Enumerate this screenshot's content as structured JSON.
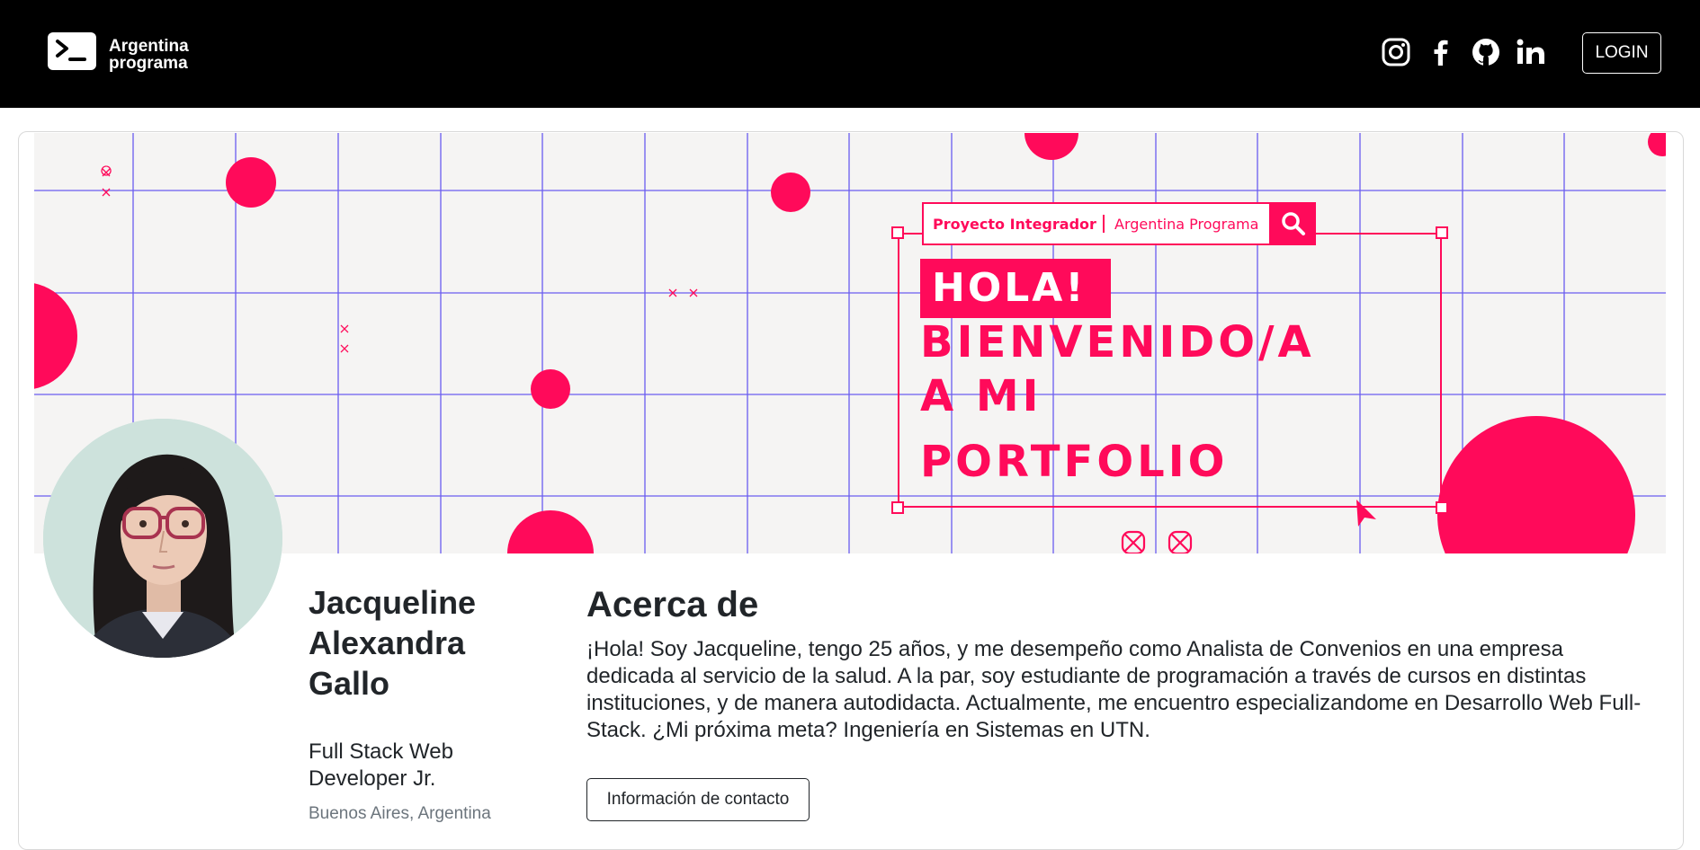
{
  "navbar": {
    "brand": {
      "line1": "Argentina",
      "line2": "programa",
      "logo_icon": "terminal-prompt-icon"
    },
    "social_icons": [
      "instagram-icon",
      "facebook-icon",
      "github-icon",
      "linkedin-icon"
    ],
    "login_label": "LOGIN"
  },
  "banner": {
    "search_label_project": "Proyecto Integrador",
    "search_label_org": "Argentina Programa",
    "search_icon": "search-icon",
    "greeting": "HOLA!",
    "line1": "BIENVENIDO/A",
    "line2": "A MI",
    "line3": "PORTFOLIO",
    "colors": {
      "accent": "#ff0a5a",
      "grid": "#6a5cf0",
      "background": "#f5f4f3"
    }
  },
  "profile": {
    "name_line1": "Jacqueline",
    "name_line2": "Alexandra",
    "name_line3": "Gallo",
    "role_line1": "Full Stack Web",
    "role_line2": "Developer Jr.",
    "location": "Buenos Aires, Argentina"
  },
  "about": {
    "title": "Acerca de",
    "text": "¡Hola! Soy Jacqueline, tengo 25 años, y me desempeño como Analista de Convenios en una empresa dedicada al servicio de la salud. A la par, soy estudiante de programación a través de cursos en distintas instituciones, y de manera autodidacta. Actualmente, me encuentro especializandome en Desarrollo Web Full-Stack. ¿Mi próxima meta? Ingeniería en Sistemas en UTN.",
    "contact_button": "Información de contacto"
  }
}
